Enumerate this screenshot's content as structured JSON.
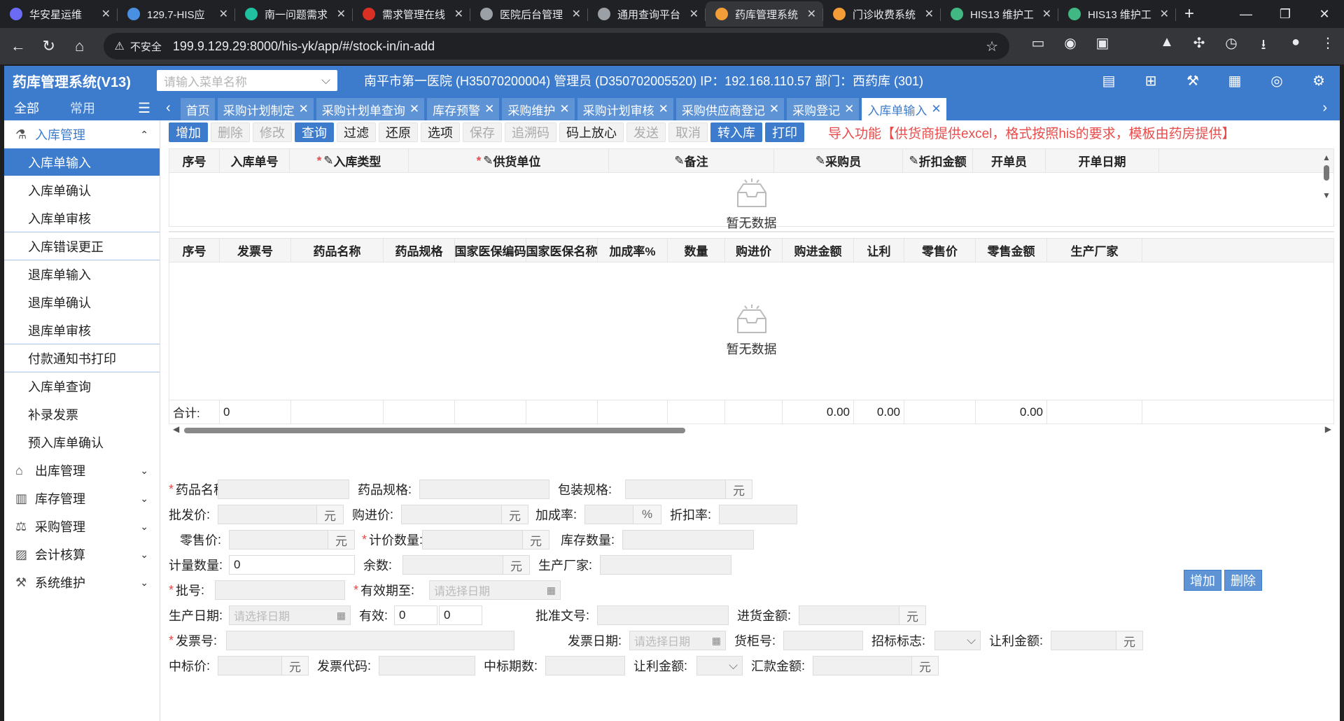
{
  "browser_tabs": [
    {
      "title": "华安星运维",
      "color": "#6b6bf5"
    },
    {
      "title": "129.7-HIS应",
      "color": "#4a90e2"
    },
    {
      "title": "南一问题需求",
      "color": "#1fbfa0"
    },
    {
      "title": "需求管理在线",
      "color": "#d93025"
    },
    {
      "title": "医院后台管理",
      "color": "#9aa0a6"
    },
    {
      "title": "通用查询平台",
      "color": "#9aa0a6"
    },
    {
      "title": "药库管理系统",
      "color": "#f29d38"
    },
    {
      "title": "门诊收费系统",
      "color": "#f29d38"
    },
    {
      "title": "HIS13 维护工",
      "color": "#41b883"
    },
    {
      "title": "HIS13 维护工",
      "color": "#41b883"
    }
  ],
  "address": {
    "security": "不安全",
    "url": "199.9.129.29:8000/his-yk/app/#/stock-in/in-add"
  },
  "header": {
    "title": "药库管理系统(V13)",
    "menu_search_placeholder": "请输入菜单名称",
    "info": "南平市第一医院 (H35070200004) 管理员 (D350702005520) IP：192.168.110.57 部门：西药库 (301)"
  },
  "nav": {
    "all": "全部",
    "common": "常用"
  },
  "page_tabs": [
    {
      "label": "首页",
      "closable": false
    },
    {
      "label": "采购计划制定",
      "closable": true
    },
    {
      "label": "采购计划单查询",
      "closable": true
    },
    {
      "label": "库存预警",
      "closable": true
    },
    {
      "label": "采购维护",
      "closable": true
    },
    {
      "label": "采购计划审核",
      "closable": true
    },
    {
      "label": "采购供应商登记",
      "closable": true
    },
    {
      "label": "采购登记",
      "closable": true
    },
    {
      "label": "入库单输入",
      "closable": true,
      "active": true
    }
  ],
  "sidebar": {
    "group_open": "入库管理",
    "items": [
      "入库单输入",
      "入库单确认",
      "入库单审核",
      "入库错误更正",
      "退库单输入",
      "退库单确认",
      "退库单审核",
      "付款通知书打印",
      "入库单查询",
      "补录发票",
      "预入库单确认"
    ],
    "groups": [
      "出库管理",
      "库存管理",
      "采购管理",
      "会计核算",
      "系统维护"
    ]
  },
  "toolbar": {
    "buttons": [
      {
        "label": "增加",
        "state": "on"
      },
      {
        "label": "删除",
        "state": "off"
      },
      {
        "label": "修改",
        "state": "off"
      },
      {
        "label": "查询",
        "state": "on"
      },
      {
        "label": "过滤",
        "state": "nm"
      },
      {
        "label": "还原",
        "state": "nm"
      },
      {
        "label": "选项",
        "state": "nm"
      },
      {
        "label": "保存",
        "state": "off"
      },
      {
        "label": "追溯码",
        "state": "off"
      },
      {
        "label": "码上放心",
        "state": "nm"
      },
      {
        "label": "发送",
        "state": "off"
      },
      {
        "label": "取消",
        "state": "off"
      },
      {
        "label": "转入库",
        "state": "on"
      },
      {
        "label": "打印",
        "state": "on"
      }
    ],
    "notice": "导入功能【供货商提供excel，格式按照his的要求，模板由药房提供】"
  },
  "grid1": {
    "columns": [
      "序号",
      "入库单号",
      "入库类型",
      "供货单位",
      "备注",
      "采购员",
      "折扣金额",
      "开单员",
      "开单日期"
    ],
    "empty": "暂无数据"
  },
  "grid2": {
    "columns": [
      "序号",
      "发票号",
      "药品名称",
      "药品规格",
      "国家医保编码",
      "国家医保名称",
      "加成率%",
      "数量",
      "购进价",
      "购进金额",
      "让利",
      "零售价",
      "零售金额",
      "生产厂家"
    ],
    "empty": "暂无数据",
    "total_label": "合计:",
    "total_count": "0",
    "total_purchase": "0.00",
    "total_discount": "0.00",
    "total_retail": "0.00"
  },
  "form": {
    "drug_name": "药品名称",
    "drug_spec": "药品规格",
    "pack_spec": "包装规格",
    "wholesale": "批发价",
    "purchase_price": "购进价",
    "markup": "加成率",
    "discount_rate": "折扣率",
    "retail": "零售价",
    "count_qty": "计价数量",
    "stock_qty": "库存数量",
    "measure_qty": "计量数量",
    "measure_val": "0",
    "remainder": "余数",
    "maker": "生产厂家",
    "batch": "批号",
    "expire": "有效期至",
    "prod_date": "生产日期",
    "valid": "有效",
    "valid_a": "0",
    "valid_b": "0",
    "approval": "批准文号",
    "purchase_amt": "进货金额",
    "invoice_no": "发票号",
    "invoice_date": "发票日期",
    "cabinet": "货柜号",
    "bid_flag": "招标标志",
    "discount_amt": "让利金额",
    "bid_price": "中标价",
    "invoice_code": "发票代码",
    "bid_period": "中标期数",
    "discount_amt2": "让利金额",
    "remit_amt": "汇款金额",
    "date_ph": "请选择日期",
    "unit_yuan": "元",
    "unit_pct": "%",
    "add_btn": "增加",
    "del_btn": "删除"
  }
}
